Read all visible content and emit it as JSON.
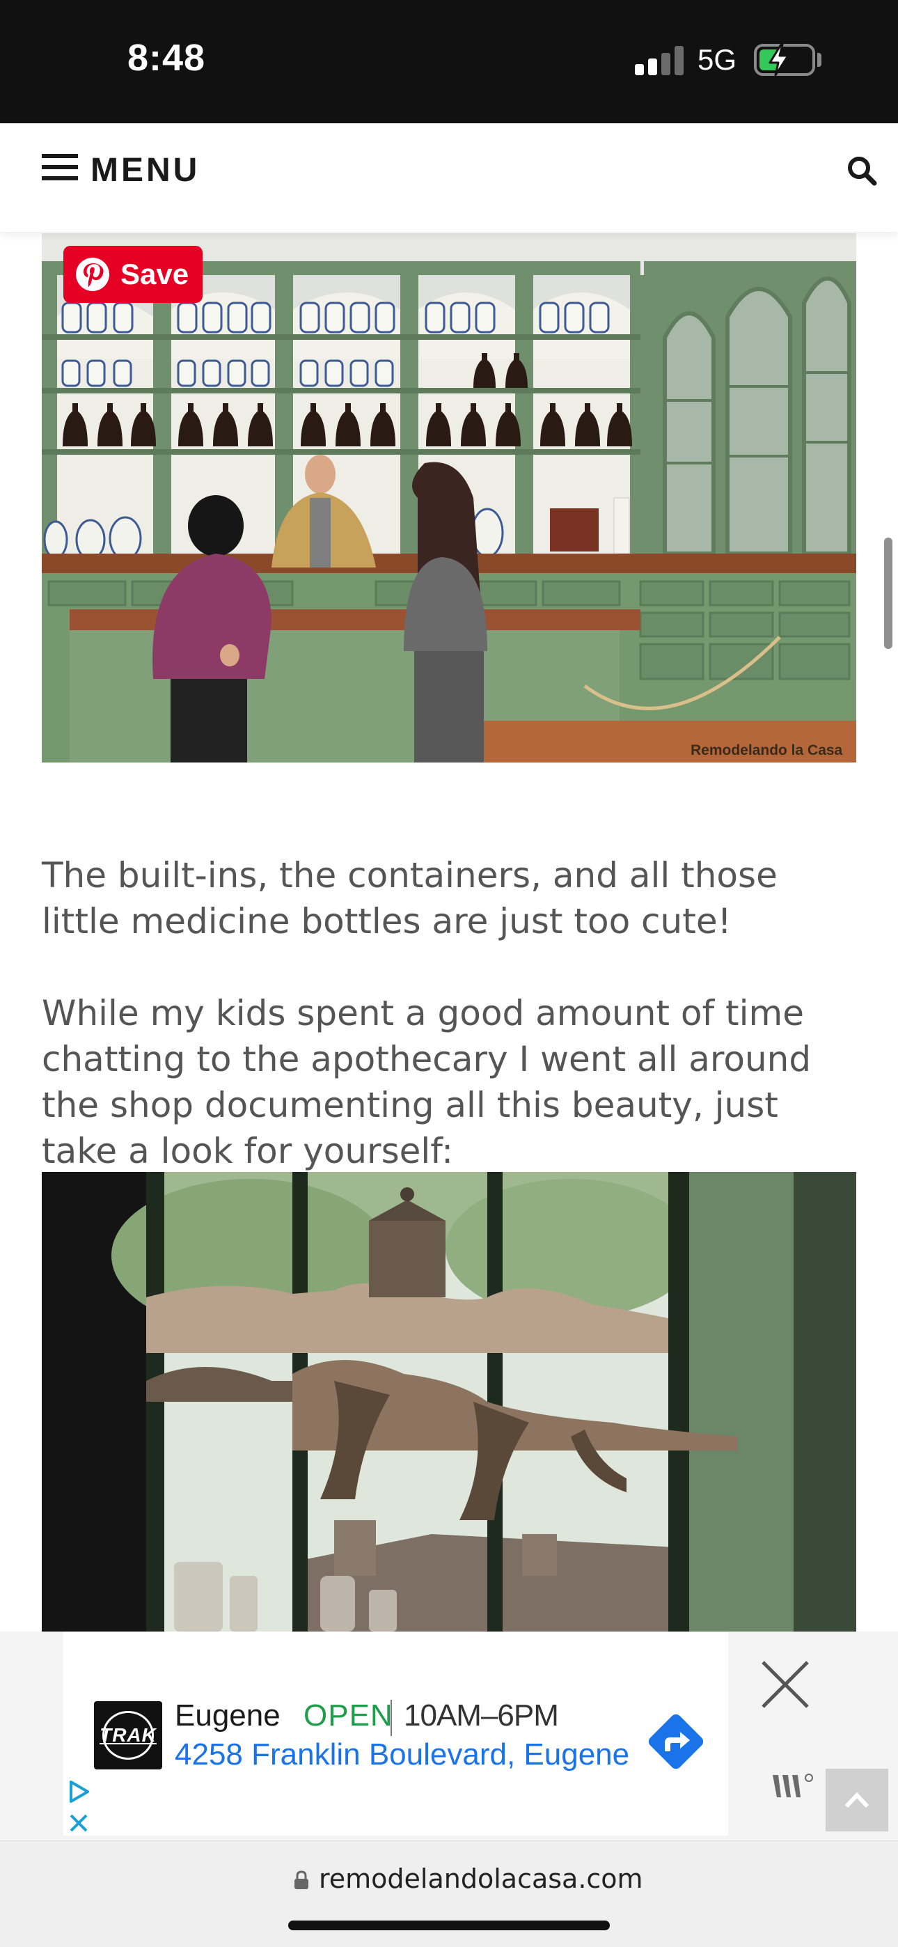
{
  "status_bar": {
    "time": "8:48",
    "network": "5G",
    "signal_bars_filled": 2,
    "signal_bars_total": 4,
    "battery_charging": true,
    "battery_level": 0.4
  },
  "header": {
    "menu_label": "MENU",
    "menu_icon": "hamburger-icon",
    "search_icon": "search-icon"
  },
  "article": {
    "pin_save_label": "Save",
    "photo1_watermark": "Remodelando la Casa",
    "para1": "The built-ins, the containers, and all those little medicine bottles are just too cute!",
    "para2": "While my kids spent a good amount of time chatting to the apothecary I went all around the shop documenting all this beauty, just take a look for yourself:"
  },
  "ad": {
    "logo_text": "TRAK",
    "title": "Eugene",
    "status": "OPEN",
    "hours": "10AM–6PM",
    "address": "4258 Franklin Boulevard, Eugene",
    "directions_icon": "directions-arrow-icon",
    "close_icon": "close-icon"
  },
  "browser": {
    "url": "remodelandolacasa.com"
  },
  "colors": {
    "status_bar_bg": "#111111",
    "signal_on": "#ffffff",
    "signal_off": "#6b6b6b",
    "battery_green": "#34c759",
    "pinterest_red": "#e60023",
    "ad_open_green": "#1e9e4a",
    "ad_link_blue": "#1a73e8",
    "body_text": "#555555"
  }
}
